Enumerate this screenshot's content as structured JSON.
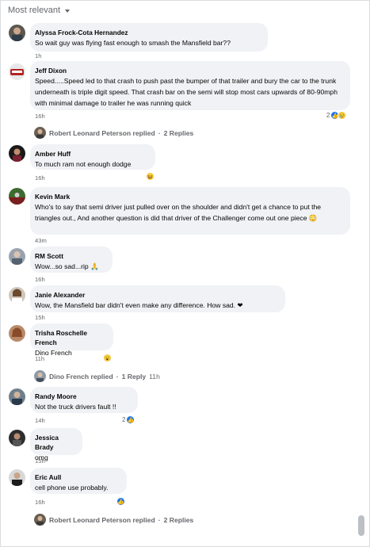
{
  "sort": {
    "label": "Most relevant"
  },
  "comments": [
    {
      "author": "Alyssa Frock-Cota Hernandez",
      "text": "So wait guy was flying fast enough to smash the Mansfield bar??",
      "time": "1h"
    },
    {
      "author": "Jeff Dixon",
      "text": "Speed.....Speed led to that crash to push past the bumper of that trailer and bury the car to the trunk underneath is triple digit speed. That crash bar on the semi will stop most cars upwards of 80-90mph with minimal damage to trailer he was running quick",
      "time": "16h",
      "reaction_count": "2",
      "replies": {
        "name": "Robert Leonard Peterson replied",
        "sep": "·",
        "count": "2 Replies"
      }
    },
    {
      "author": "Amber Huff",
      "text": "To much ram not enough dodge",
      "time": "16h"
    },
    {
      "author": "Kevin Mark",
      "text": "Who's to say that semi driver just pulled over on the shoulder and didn't get a chance to put the triangles out., And another question is did that driver of the Challenger come out one piece 😳",
      "time": "43m"
    },
    {
      "author": "RM Scott",
      "text": "Wow...so sad...rip 🙏",
      "time": "16h"
    },
    {
      "author": "Janie Alexander",
      "text": "Wow, the Mansfield bar didn't even make any difference. How sad. ❤",
      "time": "15h"
    },
    {
      "author": "Trisha Roschelle French",
      "text": "Dino French",
      "time": "11h",
      "replies": {
        "name": "Dino French replied",
        "sep": "·",
        "count": "1 Reply",
        "time": "11h"
      }
    },
    {
      "author": "Randy Moore",
      "text": "Not the truck drivers fault !!",
      "time": "14h",
      "reaction_count": "2"
    },
    {
      "author": "Jessica Brady",
      "text": "omg",
      "time": "15h"
    },
    {
      "author": "Eric Aull",
      "text": "cell phone use probably.",
      "time": "16h",
      "replies": {
        "name": "Robert Leonard Peterson replied",
        "sep": "·",
        "count": "2 Replies"
      }
    }
  ],
  "icons": {
    "like": "👍",
    "sad": "😢",
    "laugh": "😆",
    "wow": "😮"
  },
  "colors": {
    "bubble": "#f0f2f5",
    "meta": "#65676b",
    "like": "#1877f2"
  }
}
